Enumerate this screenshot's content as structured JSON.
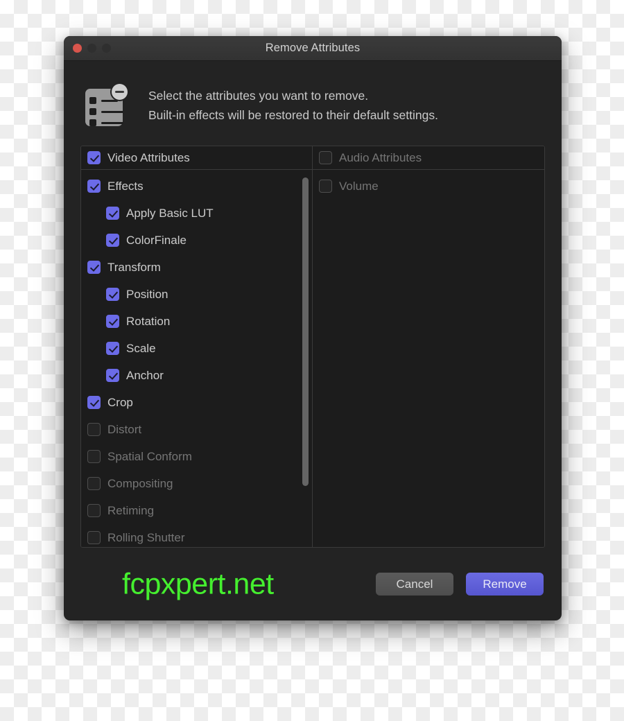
{
  "window": {
    "title": "Remove Attributes",
    "traffic_lights": [
      {
        "name": "close",
        "color": "#d9554c"
      },
      {
        "name": "minimize",
        "color": "#2f2f2f"
      },
      {
        "name": "maximize",
        "color": "#2f2f2f"
      }
    ]
  },
  "header": {
    "icon": "remove-attributes-icon",
    "badge_icon": "minus-badge-icon",
    "line1": "Select the attributes you want to remove.",
    "line2": "Built-in effects will be restored to their default settings."
  },
  "panel": {
    "columns": [
      {
        "id": "video",
        "header": {
          "label": "Video Attributes",
          "checked": true,
          "level": 1
        },
        "rows": [
          {
            "label": "Effects",
            "checked": true,
            "level": 1
          },
          {
            "label": "Apply Basic LUT",
            "checked": true,
            "level": 2
          },
          {
            "label": "ColorFinale",
            "checked": true,
            "level": 2
          },
          {
            "label": "Transform",
            "checked": true,
            "level": 1
          },
          {
            "label": "Position",
            "checked": true,
            "level": 2
          },
          {
            "label": "Rotation",
            "checked": true,
            "level": 2
          },
          {
            "label": "Scale",
            "checked": true,
            "level": 2
          },
          {
            "label": "Anchor",
            "checked": true,
            "level": 2
          },
          {
            "label": "Crop",
            "checked": true,
            "level": 1
          },
          {
            "label": "Distort",
            "checked": false,
            "level": 1
          },
          {
            "label": "Spatial Conform",
            "checked": false,
            "level": 1
          },
          {
            "label": "Compositing",
            "checked": false,
            "level": 1
          },
          {
            "label": "Retiming",
            "checked": false,
            "level": 1
          },
          {
            "label": "Rolling Shutter",
            "checked": false,
            "level": 1
          }
        ],
        "scrollbar": {
          "visible": true
        }
      },
      {
        "id": "audio",
        "header": {
          "label": "Audio Attributes",
          "checked": false,
          "level": 1
        },
        "rows": [
          {
            "label": "Volume",
            "checked": false,
            "level": 1
          }
        ],
        "scrollbar": {
          "visible": false
        }
      }
    ]
  },
  "footer": {
    "watermark": "fcpxpert.net",
    "cancel_label": "Cancel",
    "remove_label": "Remove"
  },
  "colors": {
    "accent": "#6b6be8",
    "primary_button": "#5656cf",
    "watermark": "#45ef2f",
    "close_button": "#d9554c",
    "window_background": "#232323",
    "panel_background": "#1c1c1c"
  }
}
